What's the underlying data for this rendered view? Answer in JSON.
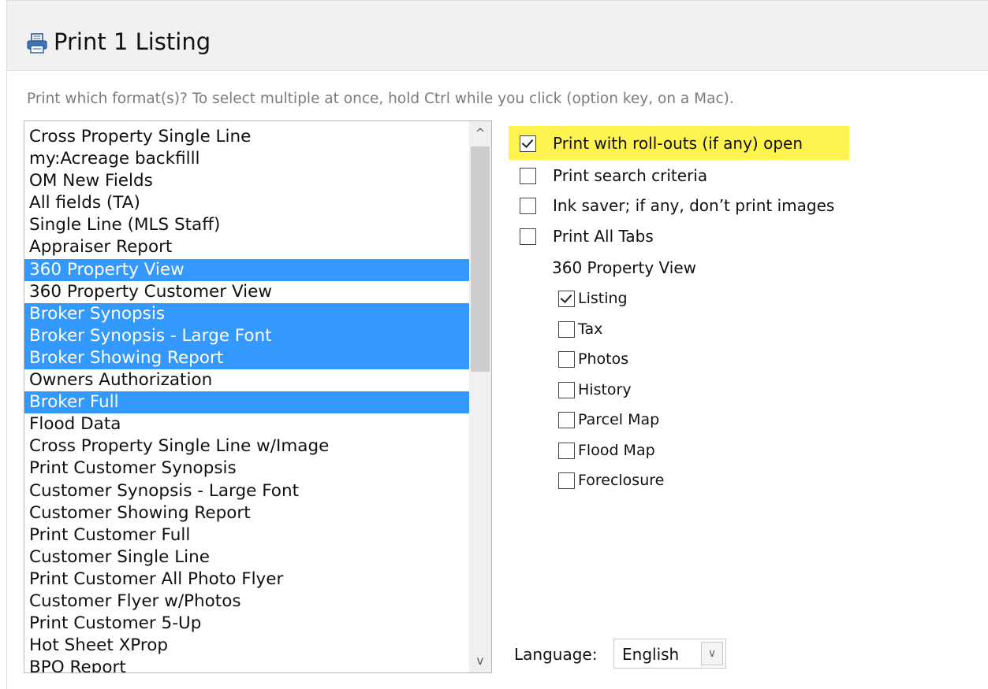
{
  "dialog": {
    "title": "Print 1 Listing",
    "icon": "printer-icon"
  },
  "instructions": "Print which format(s)? To select multiple at once, hold Ctrl while you click (option key, on a Mac).",
  "formats": {
    "options": [
      {
        "label": "Cross Property Single Line",
        "selected": false
      },
      {
        "label": "my:Acreage backfilll",
        "selected": false
      },
      {
        "label": "OM New Fields",
        "selected": false
      },
      {
        "label": "All fields (TA)",
        "selected": false
      },
      {
        "label": "Single Line (MLS Staff)",
        "selected": false
      },
      {
        "label": "Appraiser Report",
        "selected": false
      },
      {
        "label": "360 Property View",
        "selected": true
      },
      {
        "label": "360 Property Customer View",
        "selected": false
      },
      {
        "label": "Broker Synopsis",
        "selected": true
      },
      {
        "label": "Broker Synopsis - Large Font",
        "selected": true
      },
      {
        "label": "Broker Showing Report",
        "selected": true
      },
      {
        "label": "Owners Authorization",
        "selected": false
      },
      {
        "label": "Broker Full",
        "selected": true
      },
      {
        "label": "Flood Data",
        "selected": false
      },
      {
        "label": "Cross Property Single Line w/Image",
        "selected": false
      },
      {
        "label": "Print Customer Synopsis",
        "selected": false
      },
      {
        "label": "Customer Synopsis - Large Font",
        "selected": false
      },
      {
        "label": "Customer Showing Report",
        "selected": false
      },
      {
        "label": "Print Customer Full",
        "selected": false
      },
      {
        "label": "Customer Single Line",
        "selected": false
      },
      {
        "label": "Print Customer All Photo Flyer",
        "selected": false
      },
      {
        "label": "Customer Flyer w/Photos",
        "selected": false
      },
      {
        "label": "Print Customer 5-Up",
        "selected": false
      },
      {
        "label": "Hot Sheet XProp",
        "selected": false
      },
      {
        "label": "BPO Report",
        "selected": false
      }
    ],
    "scroll_up_glyph": "^",
    "scroll_down_glyph": "v"
  },
  "options": {
    "print_rollouts": {
      "label": "Print with roll-outs (if any) open",
      "checked": true,
      "highlight_color": "#fff34f"
    },
    "print_search_criteria": {
      "label": "Print search criteria",
      "checked": false
    },
    "ink_saver": {
      "label": "Ink saver; if any, don’t print images",
      "checked": false
    },
    "print_all_tabs": {
      "label": "Print All Tabs",
      "checked": false
    }
  },
  "tabs_section": {
    "label": "360 Property View",
    "tabs": [
      {
        "label": "Listing",
        "checked": true
      },
      {
        "label": "Tax",
        "checked": false
      },
      {
        "label": "Photos",
        "checked": false
      },
      {
        "label": "History",
        "checked": false
      },
      {
        "label": "Parcel Map",
        "checked": false
      },
      {
        "label": "Flood Map",
        "checked": false
      },
      {
        "label": "Foreclosure",
        "checked": false
      }
    ]
  },
  "language": {
    "label": "Language:",
    "value": "English"
  },
  "colors": {
    "selection": "#3399ff",
    "highlight": "#fff34f",
    "header_bg": "#f1f1f1"
  }
}
